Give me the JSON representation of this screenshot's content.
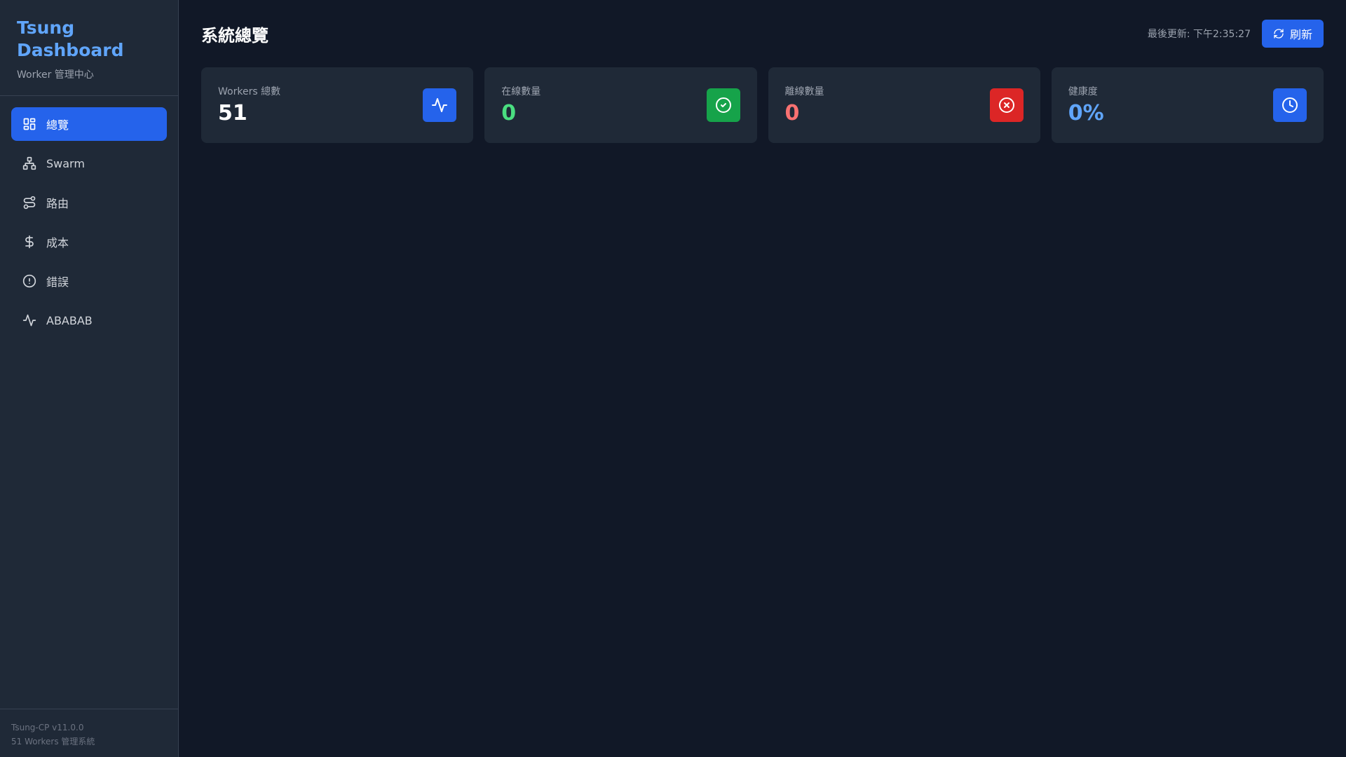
{
  "sidebar": {
    "brand_title": "Tsung Dashboard",
    "brand_subtitle": "Worker 管理中心",
    "items": [
      {
        "label": "總覽",
        "icon": "grid-icon",
        "active": true
      },
      {
        "label": "Swarm",
        "icon": "network-icon",
        "active": false
      },
      {
        "label": "路由",
        "icon": "route-icon",
        "active": false
      },
      {
        "label": "成本",
        "icon": "dollar-icon",
        "active": false
      },
      {
        "label": "錯誤",
        "icon": "alert-circle-icon",
        "active": false
      },
      {
        "label": "ABABAB",
        "icon": "activity-icon",
        "active": false
      }
    ],
    "footer_version": "Tsung-CP v11.0.0",
    "footer_desc": "51 Workers 管理系統"
  },
  "header": {
    "title": "系統總覽",
    "last_updated": "最後更新: 下午2:35:27",
    "refresh_label": "刷新"
  },
  "cards": [
    {
      "label": "Workers 總數",
      "value": "51",
      "value_color": "#ffffff",
      "icon": "activity-icon",
      "icon_bg": "#2563eb"
    },
    {
      "label": "在線數量",
      "value": "0",
      "value_color": "#4ade80",
      "icon": "check-circle-icon",
      "icon_bg": "#16a34a"
    },
    {
      "label": "離線數量",
      "value": "0",
      "value_color": "#f87171",
      "icon": "x-circle-icon",
      "icon_bg": "#dc2626"
    },
    {
      "label": "健康度",
      "value": "0%",
      "value_color": "#60a5fa",
      "icon": "clock-icon",
      "icon_bg": "#2563eb"
    }
  ],
  "colors": {
    "accent": "#2563eb",
    "brand": "#60a5fa",
    "background": "#111827",
    "surface": "#1f2937"
  }
}
